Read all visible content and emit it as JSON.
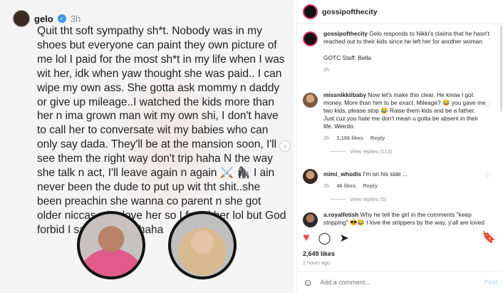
{
  "story": {
    "username": "gelo",
    "time": "3h",
    "text": "Quit tht soft sympathy sh*t. Nobody was in my shoes but everyone can paint they own picture of me lol I paid for the most sh*t in my life when I was wit her, idk when yaw thought she was paid.. I can wipe my own ass. She gotta ask mommy n daddy or give up mileage..I watched the kids more than her n ima grown man wit my own shi, I don't have to call her to conversate wit my babies who can only say dada. They'll be at the mansion soon, I'll see them the right way don't trip haha N the way she talk n act, I'll leave again n again ⚔️ 🦍 I ain never been the dude to put up wit tht shit..she been preachin she wanna co parent n she got older niccas who love her so I freed her lol but God forbid I say anything haha"
  },
  "panel": {
    "header_user": "gossipofthecity",
    "caption": {
      "user": "gossipofthecity",
      "text": "Gelo responds to Nikki's claims that he hasn't reached out to their kids since he left her for another woman",
      "staff": "GOTC Staff: Bella",
      "time": "2h"
    },
    "comments": [
      {
        "user": "missnikkiibaby",
        "text": "Now let's make this clear. He know I got money. More than him to be exact. Mileage? 😂 you gave me two kids, please stop 😂 Raise them kids and be a father. Just cuz you hate me don't mean u gotta be absent in their life. Weirdo.",
        "time": "2h",
        "likes": "1,196 likes",
        "reply": "Reply",
        "view_replies": "View replies (113)"
      },
      {
        "user": "mimi_whodis",
        "text": "I'm on his side ...",
        "time": "2h",
        "likes": "46 likes",
        "reply": "Reply",
        "view_replies": "View replies (5)"
      },
      {
        "user": "a.royalfetish",
        "text": "Why he tell the girl in the comments \"keep stripping\" 😎😂 I love the strippers by the way, y'all are loved"
      }
    ],
    "likes_total": "2,649 likes",
    "post_time": "2 hours ago",
    "add_comment_placeholder": "Add a comment...",
    "post_label": "Post"
  }
}
